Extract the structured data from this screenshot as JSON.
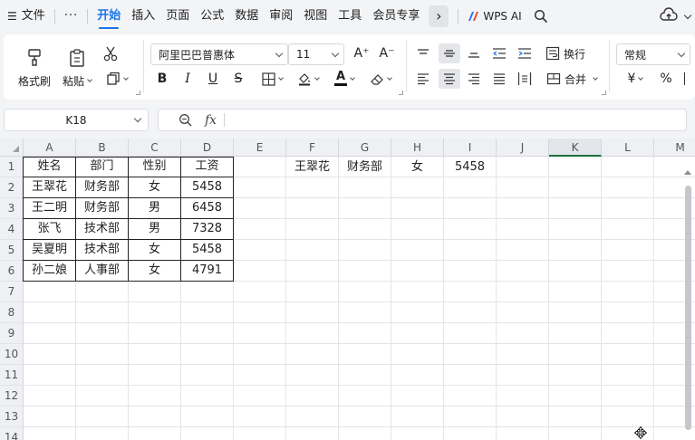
{
  "menu": {
    "file_icon": "hamburger-icon",
    "file": "文件",
    "more_dots": "···",
    "tabs": [
      "开始",
      "插入",
      "页面",
      "公式",
      "数据",
      "审阅",
      "视图",
      "工具",
      "会员专享"
    ],
    "more_arrow": "›",
    "wps_ai": "WPS AI"
  },
  "ribbon": {
    "format_painter": "格式刷",
    "paste": "粘贴",
    "font_name": "阿里巴巴普惠体",
    "font_size": "11",
    "wrap": "换行",
    "merge": "合并",
    "number_format": "常规",
    "currency": "¥",
    "percent": "%",
    "bold": "B",
    "italic": "I",
    "underline": "U",
    "strike": "S",
    "font_color_letter": "A",
    "grow_font": "A⁺",
    "shrink_font": "A⁻"
  },
  "formula_bar": {
    "cell_ref": "K18",
    "fx": "fx",
    "value": ""
  },
  "grid": {
    "columns": [
      "A",
      "B",
      "C",
      "D",
      "E",
      "F",
      "G",
      "H",
      "I",
      "J",
      "K",
      "L",
      "M"
    ],
    "rows": [
      "1",
      "2",
      "3",
      "4",
      "5",
      "6",
      "7",
      "8",
      "9",
      "10",
      "11",
      "12",
      "13",
      "14"
    ],
    "selected_column": "K",
    "table": [
      [
        "姓名",
        "部门",
        "性别",
        "工资"
      ],
      [
        "王翠花",
        "财务部",
        "女",
        "5458"
      ],
      [
        "王二明",
        "财务部",
        "男",
        "6458"
      ],
      [
        "张飞",
        "技术部",
        "男",
        "7328"
      ],
      [
        "吴夏明",
        "技术部",
        "女",
        "5458"
      ],
      [
        "孙二娘",
        "人事部",
        "女",
        "4791"
      ]
    ],
    "lookup_row": [
      "王翠花",
      "财务部",
      "女",
      "5458"
    ]
  },
  "colors": {
    "accent": "#1a73e8",
    "selected_col_bar": "#1f6f3a",
    "font_color_bar": "#111111"
  }
}
